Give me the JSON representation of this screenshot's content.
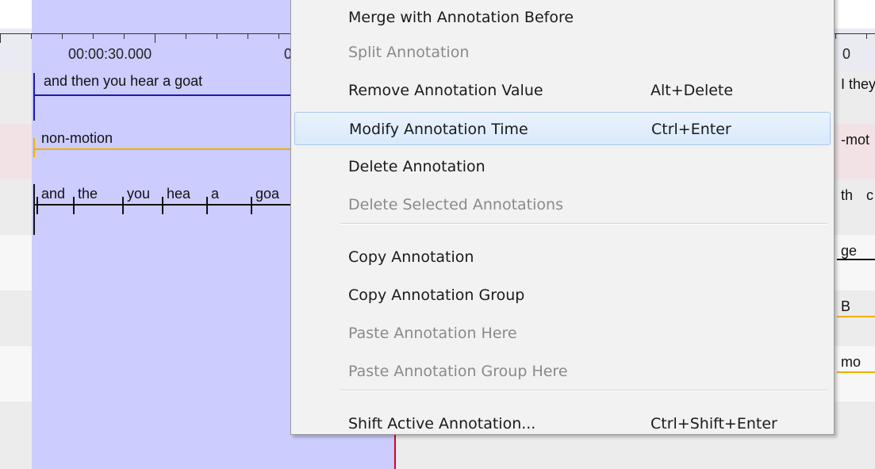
{
  "ruler": {
    "time_label": "00:00:30.000",
    "partial_left": "0",
    "partial_right": "0"
  },
  "tiers": {
    "utterance_text": "and then you hear a goat",
    "utterance_partial": "I they",
    "motion_text": "non-motion",
    "motion_partial": "-mot",
    "words": [
      "and",
      "the",
      "you",
      "hea",
      "a",
      "goa"
    ],
    "words_partial": [
      "th",
      "c"
    ],
    "row4_partial": "ge",
    "row5_partial": "B",
    "row6_partial": "mo"
  },
  "context_menu": {
    "items": [
      {
        "label": "Merge with Annotation Before",
        "shortcut": "",
        "enabled": true
      },
      {
        "label": "Split Annotation",
        "shortcut": "",
        "enabled": false
      },
      {
        "label": "Remove Annotation Value",
        "shortcut": "Alt+Delete",
        "enabled": true
      },
      {
        "label": "Modify Annotation Time",
        "shortcut": "Ctrl+Enter",
        "enabled": true,
        "highlighted": true
      },
      {
        "label": "Delete Annotation",
        "shortcut": "",
        "enabled": true
      },
      {
        "label": "Delete Selected Annotations",
        "shortcut": "",
        "enabled": false
      },
      {
        "label": "Copy Annotation",
        "shortcut": "",
        "enabled": true
      },
      {
        "label": "Copy Annotation Group",
        "shortcut": "",
        "enabled": true
      },
      {
        "label": "Paste Annotation Here",
        "shortcut": "",
        "enabled": false
      },
      {
        "label": "Paste Annotation Group Here",
        "shortcut": "",
        "enabled": false
      },
      {
        "label": "Shift Active Annotation...",
        "shortcut": "Ctrl+Shift+Enter",
        "enabled": true
      }
    ]
  },
  "colors": {
    "selection": "#ccccff",
    "utterance_line": "#1a1aa8",
    "motion_line": "#f0b000",
    "motion_row": "#f2e2e6",
    "crosshair": "#e0001a",
    "menu_highlight": "#d9e9fb"
  }
}
